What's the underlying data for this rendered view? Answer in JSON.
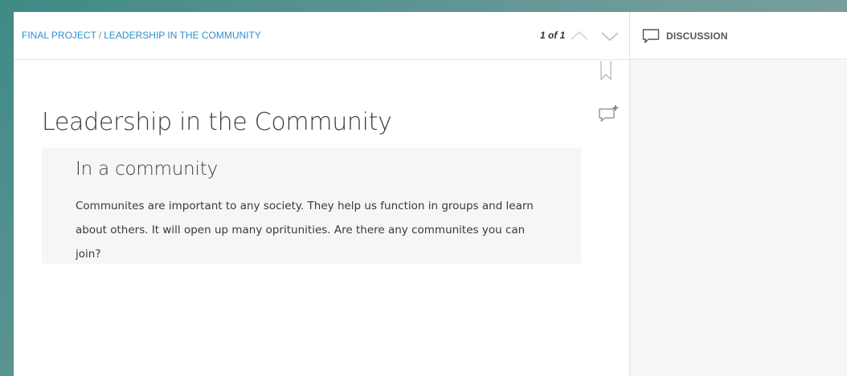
{
  "header": {
    "breadcrumb": {
      "parent": "FINAL PROJECT",
      "separator": "/",
      "current": "LEADERSHIP IN THE COMMUNITY"
    },
    "pager": "1 of 1",
    "icons": {
      "previous": "chevron-up-icon",
      "next": "chevron-down-icon"
    }
  },
  "side_panel": {
    "tab_label": "DISCUSSION",
    "tab_icon": "chat-bubble-icon"
  },
  "tools": {
    "bookmark_icon": "bookmark-icon",
    "add_comment_icon": "add-comment-icon"
  },
  "content": {
    "title": "Leadership in the Community",
    "section": {
      "heading": "In a community",
      "body": "Communites are important to any society. They help us function in groups and learn about others. It will open up many opritunities. Are there any communites you can join?"
    }
  },
  "colors": {
    "link": "#2f8fcb",
    "background_gradient_start": "#3f8a86",
    "background_gradient_end": "#88a3a1",
    "panel": "#f6f6f6"
  }
}
